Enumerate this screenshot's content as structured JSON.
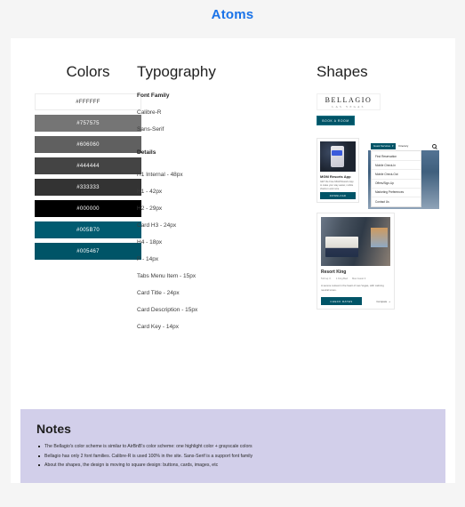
{
  "page": {
    "title": "Atoms",
    "title_color": "#1a73e8",
    "background": "#f5f5f5"
  },
  "columns": {
    "colors": {
      "heading": "Colors",
      "swatches": [
        {
          "hex": "#FFFFFF",
          "label": "#FFFFFF",
          "text_tone": "light"
        },
        {
          "hex": "#757575",
          "label": "#757575",
          "text_tone": "dark"
        },
        {
          "hex": "#606060",
          "label": "#606060",
          "text_tone": "dark"
        },
        {
          "hex": "#444444",
          "label": "#444444",
          "text_tone": "dark"
        },
        {
          "hex": "#333333",
          "label": "#333333",
          "text_tone": "dark"
        },
        {
          "hex": "#000000",
          "label": "#000000",
          "text_tone": "dark"
        },
        {
          "hex": "#005B70",
          "label": "#005B70",
          "text_tone": "dark"
        },
        {
          "hex": "#005467",
          "label": "#005467",
          "text_tone": "dark"
        }
      ]
    },
    "typography": {
      "heading": "Typography",
      "font_family_label": "Font Family",
      "font_primary": "Calibre-R",
      "font_secondary": "Sans-Serif",
      "details_label": "Details",
      "scale": [
        "H1 Internal - 48px",
        "H1 - 42px",
        "H2 - 29px",
        "Card H3 - 24px",
        "H4 - 18px",
        "P - 14px",
        "Tabs Menu Item - 15px",
        "Card Title - 24px",
        "Card Description - 15px",
        "Card Key - 14px"
      ]
    },
    "shapes": {
      "heading": "Shapes",
      "logo": {
        "main": "BELLAGIO",
        "sub": "LAS VEGAS"
      },
      "book_button": "BOOK A ROOM",
      "promo_card": {
        "title": "MGM Resorts App",
        "description": "GET the Free MGM Resorts App to make your stay easier, mobile check-in and more",
        "button": "DOWNLOAD"
      },
      "dropdown": {
        "pill_label": "Guest Services",
        "pill_caret": "▾",
        "nav_link": "Itinerary",
        "search_icon": "search-icon",
        "items": [
          "Find Reservation",
          "Mobile Check-In",
          "Mobile Check-Out",
          "Offers/Sign-Up",
          "Marketing Preferences",
          "Contact Us"
        ]
      },
      "room_card": {
        "title": "Resort King",
        "meta": [
          "510 sq. ft.",
          "1 King Bed",
          "Max Guest 3"
        ],
        "description": "A serene retreat in the heart of Las Vegas, with calming neutral tones.",
        "button": "CHECK RATES",
        "compare": "Compare",
        "compare_icon": "plus-icon"
      }
    }
  },
  "notes": {
    "title": "Notes",
    "background": "#d2cfea",
    "items": [
      "The Bellagio's color scheme is similar to AirBnB's color scheme: one highlight color + grayscale colors",
      "Bellagio has only 2 font families. Calibre-R is used 100% in the site. Sans-Serif is a support font family",
      "About the shapes, the design is moving to square design: buttons, cards, images, etc"
    ]
  }
}
